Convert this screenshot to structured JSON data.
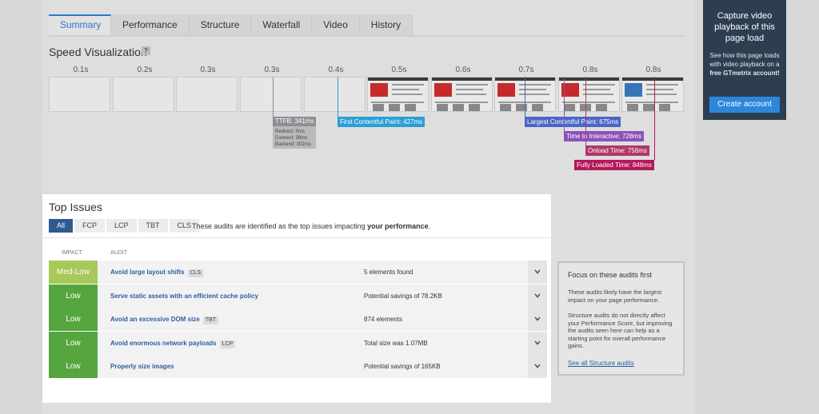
{
  "tabs": [
    "Summary",
    "Performance",
    "Structure",
    "Waterfall",
    "Video",
    "History"
  ],
  "speed_visualization": {
    "title": "Speed Visualization",
    "help": "?",
    "times": [
      "0.1s",
      "0.2s",
      "0.3s",
      "0.3s",
      "0.4s",
      "0.5s",
      "0.6s",
      "0.7s",
      "0.8s",
      "0.8s"
    ],
    "markers": {
      "ttfb": "TTFB: 341ms",
      "ttfb_details": [
        "Redirect: 0ms",
        "Connect: 39ms",
        "Backend: 302ms"
      ],
      "fcp": "First Contentful Paint: 427ms",
      "lcp": "Largest Contentful Paint: 675ms",
      "tti": "Time to Interactive: 728ms",
      "onload": "Onload Time: 756ms",
      "fully_loaded": "Fully Loaded Time: 848ms"
    },
    "colors": {
      "ttfb": "#8e8e95",
      "fcp": "#2a9fd6",
      "lcp": "#4a67c7",
      "tti": "#8a52b8",
      "onload": "#b0386a",
      "fully_loaded": "#b3195a"
    }
  },
  "ad": {
    "title": "Capture video playback of this page load",
    "body_prefix": "See how this page loads with video playback on a ",
    "body_bold": "free GTmetrix account!",
    "button": "Create account"
  },
  "top_issues": {
    "title": "Top Issues",
    "filters": [
      "All",
      "FCP",
      "LCP",
      "TBT",
      "CLS"
    ],
    "note_prefix": "These audits are identified as the top issues impacting ",
    "note_bold": "your performance",
    "note_suffix": ".",
    "col_impact": "IMPACT",
    "col_audit": "AUDIT",
    "rows": [
      {
        "impact": "Med-Low",
        "audit": "Avoid large layout shifts",
        "tag": "CLS",
        "result": "5 elements found"
      },
      {
        "impact": "Low",
        "audit": "Serve static assets with an efficient cache policy",
        "tag": "",
        "result": "Potential savings of 78.2KB"
      },
      {
        "impact": "Low",
        "audit": "Avoid an excessive DOM size",
        "tag": "TBT",
        "result": "874 elements"
      },
      {
        "impact": "Low",
        "audit": "Avoid enormous network payloads",
        "tag": "LCP",
        "result": "Total size was 1.07MB"
      },
      {
        "impact": "Low",
        "audit": "Properly size images",
        "tag": "",
        "result": "Potential savings of 165KB"
      }
    ],
    "impact_colors": {
      "Med-Low": "#a6c95a",
      "Low": "#55a63f"
    }
  },
  "focus": {
    "title": "Focus on these audits first",
    "p1": "These audits likely have the largest impact on your page performance.",
    "p2": "Structure audits do not directly affect your Performance Score, but improving the audits seen here can help as a starting point for overall performance gains.",
    "link": "See all Structure audits"
  }
}
